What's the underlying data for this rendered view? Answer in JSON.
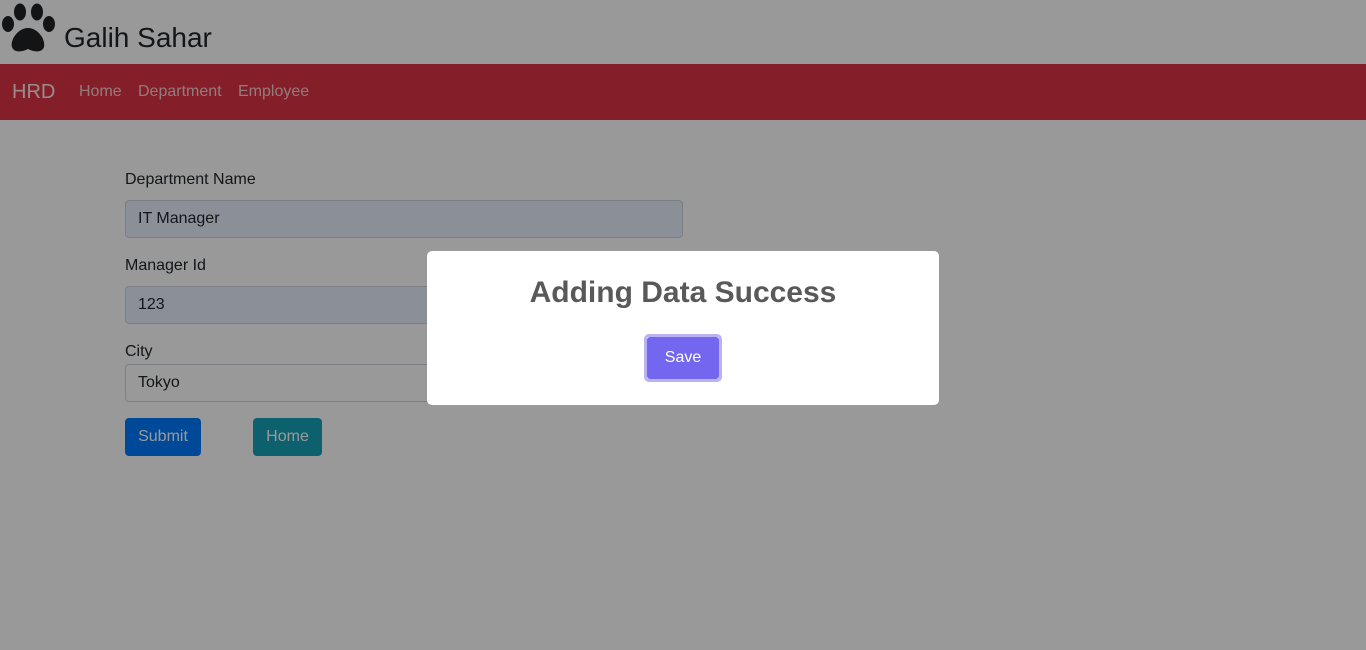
{
  "header": {
    "brand_name": "Galih Sahar",
    "logo_icon": "paw-icon"
  },
  "navbar": {
    "brand": "HRD",
    "links": [
      "Home",
      "Department",
      "Employee"
    ],
    "background_color": "#dc3545"
  },
  "form": {
    "department_name": {
      "label": "Department Name",
      "value": "IT Manager"
    },
    "manager_id": {
      "label": "Manager Id",
      "value": "123"
    },
    "city": {
      "label": "City",
      "value": "Tokyo"
    },
    "submit_label": "Submit",
    "home_label": "Home"
  },
  "modal": {
    "title": "Adding Data Success",
    "confirm_label": "Save",
    "confirm_color": "#7367f0"
  }
}
